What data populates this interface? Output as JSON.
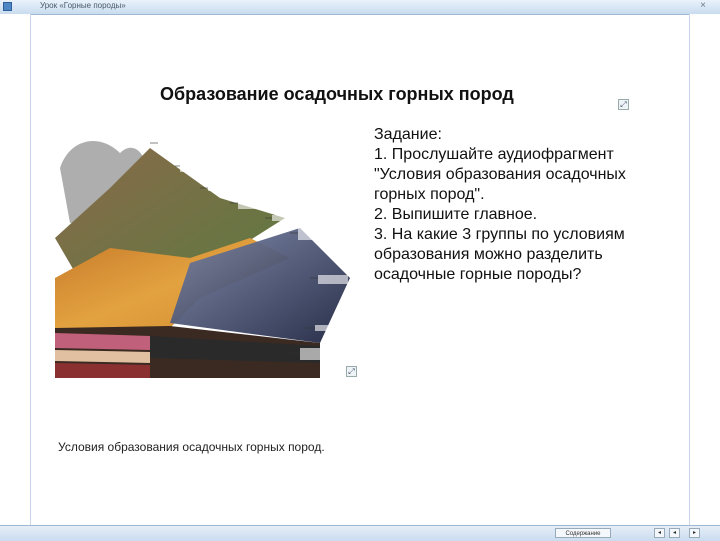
{
  "window": {
    "title": "Урок «Горные породы»",
    "close_glyph": "×"
  },
  "slide": {
    "title": "Образование осадочных горных пород",
    "task_lines": [
      "Задание:",
      "1. Прослушайте аудиофрагмент",
      "\"Условия образования осадочных",
      "горных пород\".",
      "2. Выпишите главное.",
      "3. На какие 3 группы по условиям",
      "образования можно разделить",
      "осадочные горные породы?"
    ],
    "caption": "Условия образования осадочных горных пород."
  },
  "bottom": {
    "content_button": "Содержание",
    "nav": [
      "◂",
      "◂",
      "▸"
    ]
  }
}
